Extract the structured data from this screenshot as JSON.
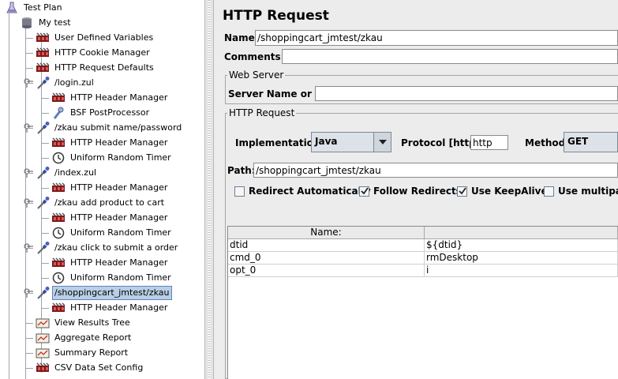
{
  "tree": {
    "items": [
      {
        "label": "Test Plan",
        "icon": "flask-icon"
      },
      {
        "label": "My test",
        "icon": "thread-group-icon"
      },
      {
        "label": "User Defined Variables",
        "icon": "config-element-icon"
      },
      {
        "label": "HTTP Cookie Manager",
        "icon": "config-element-icon"
      },
      {
        "label": "HTTP Request Defaults",
        "icon": "config-element-icon"
      },
      {
        "label": "/login.zul",
        "icon": "sampler-pipette-icon"
      },
      {
        "label": "HTTP Header Manager",
        "icon": "config-element-icon"
      },
      {
        "label": "BSF PostProcessor",
        "icon": "postprocessor-icon"
      },
      {
        "label": "/zkau  submit  name/password",
        "icon": "sampler-pipette-icon"
      },
      {
        "label": "HTTP Header Manager",
        "icon": "config-element-icon"
      },
      {
        "label": "Uniform Random Timer",
        "icon": "timer-icon"
      },
      {
        "label": "/index.zul",
        "icon": "sampler-pipette-icon"
      },
      {
        "label": "HTTP Header Manager",
        "icon": "config-element-icon"
      },
      {
        "label": "/zkau  add  product  to cart",
        "icon": "sampler-pipette-icon"
      },
      {
        "label": "HTTP Header Manager",
        "icon": "config-element-icon"
      },
      {
        "label": "Uniform Random Timer",
        "icon": "timer-icon"
      },
      {
        "label": "/zkau  click to submit a order",
        "icon": "sampler-pipette-icon"
      },
      {
        "label": "HTTP Header Manager",
        "icon": "config-element-icon"
      },
      {
        "label": "Uniform Random Timer",
        "icon": "timer-icon"
      },
      {
        "label": "/shoppingcart_jmtest/zkau",
        "icon": "sampler-pipette-icon",
        "selected": true
      },
      {
        "label": "HTTP Header Manager",
        "icon": "config-element-icon"
      },
      {
        "label": "View Results Tree",
        "icon": "listener-graph-icon"
      },
      {
        "label": "Aggregate Report",
        "icon": "listener-graph-icon"
      },
      {
        "label": "Summary Report",
        "icon": "listener-graph-icon"
      },
      {
        "label": "CSV Data Set Config",
        "icon": "config-element-icon"
      }
    ]
  },
  "panel": {
    "title": "HTTP Request",
    "name_label": "Name:",
    "name_value": "/shoppingcart_jmtest/zkau",
    "comments_label": "Comments:",
    "comments_value": "",
    "web_server_legend": "Web Server",
    "server_label": "Server Name or IP:",
    "server_value": "",
    "http_request_legend": "HTTP Request",
    "implementation_label": "Implementation:",
    "implementation_value": "Java",
    "protocol_label": "Protocol [http]:",
    "protocol_value": "http",
    "method_label": "Method:",
    "method_value": "GET",
    "path_label": "Path:",
    "path_value": "/shoppingcart_jmtest/zkau",
    "checkboxes": [
      {
        "label": "Redirect Automatically",
        "checked": false
      },
      {
        "label": "Follow Redirects",
        "checked": true
      },
      {
        "label": "Use KeepAlive",
        "checked": true
      },
      {
        "label": "Use multipart",
        "checked": false
      }
    ],
    "table": {
      "headers": [
        "Name:",
        ""
      ],
      "rows": [
        {
          "name": "dtid",
          "value": "${dtid}"
        },
        {
          "name": "cmd_0",
          "value": "rmDesktop"
        },
        {
          "name": "opt_0",
          "value": "i"
        }
      ]
    }
  }
}
